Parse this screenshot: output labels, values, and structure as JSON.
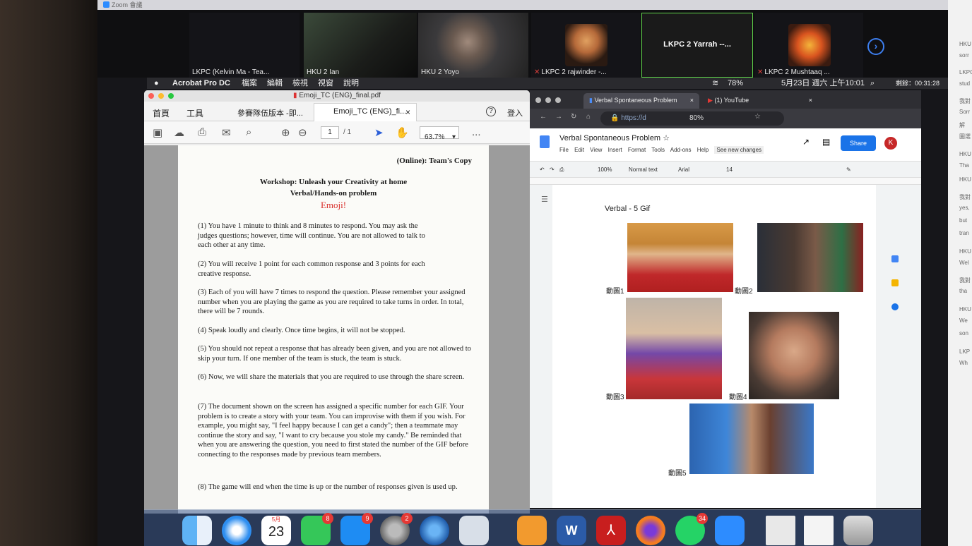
{
  "zoom": {
    "titlebar": "Zoom 會議",
    "participants": [
      {
        "name": "LKPC (Kelvin Ma - Tea...",
        "muted": false
      },
      {
        "name": "HKU 2 Ian",
        "muted": false
      },
      {
        "name": "HKU 2 Yoyo",
        "muted": false
      },
      {
        "name": "LKPC 2 rajwinder -...",
        "muted": true
      },
      {
        "name": "LKPC 2 Yarrah --...",
        "muted": false
      },
      {
        "name": "LKPC 2 Mushtaaq ...",
        "muted": true
      }
    ],
    "next_icon": "chevron-right-icon",
    "timer": "剩餘：00:31:28"
  },
  "menubar": {
    "app": "Acrobat Pro DC",
    "items": [
      "檔案",
      "編輯",
      "檢視",
      "視窗",
      "說明"
    ],
    "battery": "78%",
    "datetime": "5月23日 週六 上午10:01"
  },
  "pdf": {
    "window_title": "Emoji_TC (ENG)_final.pdf",
    "tabs": {
      "home": "首頁",
      "tools": "工具",
      "tab1": "參賽隊伍版本 -即...",
      "tab2": "Emoji_TC (ENG)_fi...",
      "close": "×",
      "help": "?",
      "login": "登入"
    },
    "page_num": "1",
    "page_total": "/ 1",
    "zoom": "63.7%",
    "more": "...",
    "doc": {
      "copy_line": "(Online): Team's Copy",
      "title1": "Workshop: Unleash your Creativity at home",
      "title2": "Verbal/Hands-on problem",
      "title3": "Emoji!",
      "p1": "(1) You have 1 minute to think and 8 minutes to respond. You may ask the judges questions; however, time will continue. You are not allowed to talk to each other at any time.",
      "p2": "(2) You will receive 1 point for each common response and 3 points for each creative response.",
      "p3": "(3) Each of you will have 7 times to respond the question. Please remember your assigned number when you are playing the game as you are required to take turns in order. In total, there will be 7 rounds.",
      "p4": "(4) Speak loudly and clearly. Once time begins, it will not be stopped.",
      "p5": "(5) You should not repeat a response that has already been given, and you are not allowed to skip your turn. If one member of the team is stuck, the team is stuck.",
      "p6": "(6) Now, we will share the materials that you are required to use through the share screen.",
      "p7": "(7) The document shown on the screen has assigned a specific number for each GIF. Your problem is to create a story with your team. You can improvise with them if you wish. For example, you might say, \"I feel happy because I can get a candy\"; then a teammate may continue the story and say, \"I want to cry because you stole my candy.\" Be reminded that when you are answering the question, you need to first stated the number of the GIF before connecting to the responses made by previous team members.",
      "p8": "(8) The game will end when the time is up or the number of responses given is used up."
    }
  },
  "browser": {
    "tab1": "Verbal Spontaneous Problem",
    "tab2": "(1) YouTube",
    "url": "https://d",
    "zoom": "80%",
    "gdoc": {
      "title": "Verbal Spontaneous Problem",
      "menu": [
        "File",
        "Edit",
        "View",
        "Insert",
        "Format",
        "Tools",
        "Add-ons",
        "Help",
        "See new changes"
      ],
      "share": "Share",
      "avatar": "K",
      "toolbar": {
        "zoom": "100%",
        "style": "Normal text",
        "font": "Arial",
        "size": "14"
      },
      "heading": "Verbal - 5 Gif",
      "gifs": [
        "動圖1",
        "動圖2",
        "動圖3",
        "動圖4",
        "動圖5"
      ]
    }
  },
  "dock": {
    "badges": {
      "facetime": "8",
      "appstore": "9",
      "prefs": "2",
      "whatsapp": "34"
    },
    "calendar_month": "5月",
    "calendar_day": "23"
  },
  "chat": {
    "lines": [
      "HKU",
      "sorr",
      "LKPC",
      "stud",
      "我對",
      "Sorr",
      "解",
      "圖選",
      "HKU",
      "Tha",
      "HKU",
      "我對",
      "yes,",
      "but",
      "tran",
      "HKU",
      "Wel",
      "我對",
      "tha",
      "HKU",
      "We",
      "son",
      "LKP",
      "Wh"
    ]
  }
}
